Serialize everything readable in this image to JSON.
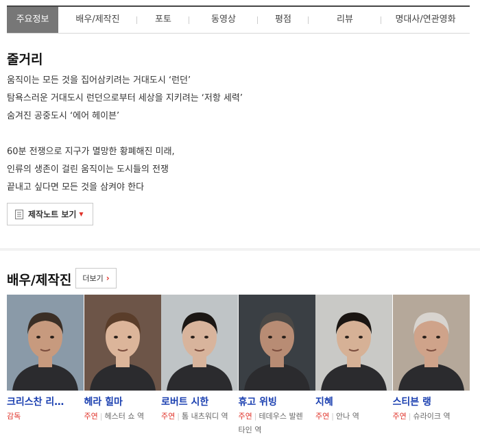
{
  "tabs": [
    {
      "label": "주요정보",
      "active": true,
      "width": 75
    },
    {
      "label": "배우/제작진",
      "active": false,
      "width": 115
    },
    {
      "label": "포토",
      "active": false,
      "width": 76
    },
    {
      "label": "동영상",
      "active": false,
      "width": 100
    },
    {
      "label": "평점",
      "active": false,
      "width": 74
    },
    {
      "label": "리뷰",
      "active": false,
      "width": 106
    },
    {
      "label": "명대사/연관영화",
      "active": false,
      "width": 129
    }
  ],
  "synopsis": {
    "title": "줄거리",
    "lines": [
      "움직이는 모든 것을 집어삼키려는 거대도시 ‘런던’",
      " 탐욕스러운 거대도시 런던으로부터 세상을 지키려는 ‘저항 세력’",
      " 숨겨진 공중도시 ‘에어 헤이븐’",
      "",
      " 60분 전쟁으로 지구가 멸망한 황폐해진 미래,",
      " 인류의 생존이 걸린 움직이는 도시들의 전쟁",
      " 끝내고 싶다면 모든 것을 삼켜야 한다"
    ],
    "note_button": "제작노트 보기"
  },
  "cast": {
    "title": "배우/제작진",
    "more_label": "더보기",
    "people": [
      {
        "name": "크리스찬 리…",
        "type": "감독",
        "role": "",
        "bg": "#8a9aa8",
        "skin": "#c79a7e",
        "hair": "#3b2f26"
      },
      {
        "name": "헤라 힐마",
        "type": "주연",
        "role": "헤스터 쇼 역",
        "bg": "#6d5548",
        "skin": "#dcb59a",
        "hair": "#5a3d2a"
      },
      {
        "name": "로버트 시한",
        "type": "주연",
        "role": "톰 내츠워디 역",
        "bg": "#bfc4c6",
        "skin": "#d8b49c",
        "hair": "#1b1714"
      },
      {
        "name": "휴고 위빙",
        "type": "주연",
        "role": "테데우스 발렌타인 역",
        "bg": "#3a3f44",
        "skin": "#b88c74",
        "hair": "#4b4845"
      },
      {
        "name": "지혜",
        "type": "주연",
        "role": "안나 역",
        "bg": "#c9c9c6",
        "skin": "#d6b196",
        "hair": "#1a1512"
      },
      {
        "name": "스티븐 랭",
        "type": "주연",
        "role": "슈라이크 역",
        "bg": "#b5a89a",
        "skin": "#cfa38a",
        "hair": "#d8d4cf"
      }
    ]
  }
}
